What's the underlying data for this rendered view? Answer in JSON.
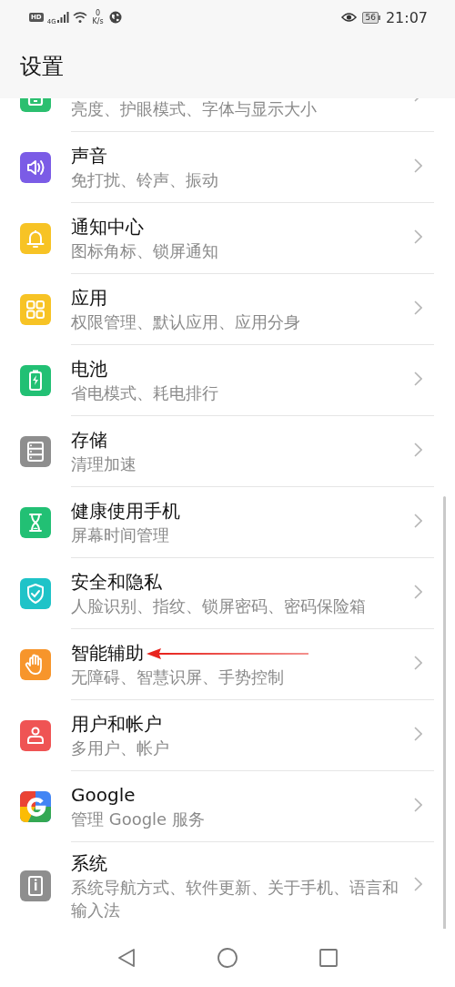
{
  "status_bar": {
    "hd": "HD",
    "network": "4G",
    "speed_value": "0",
    "speed_unit": "K/s",
    "battery": "56",
    "time": "21:07"
  },
  "header": {
    "title": "设置"
  },
  "settings": [
    {
      "kind": "display",
      "color": "#2bbf6f",
      "subtitle": "亮度、护眼模式、字体与显示大小",
      "pointed": false
    },
    {
      "kind": "sound",
      "color": "#7b5ce6",
      "title": "声音",
      "subtitle": "免打扰、铃声、振动",
      "pointed": false
    },
    {
      "kind": "bell",
      "color": "#f7c325",
      "title": "通知中心",
      "subtitle": "图标角标、锁屏通知",
      "pointed": false
    },
    {
      "kind": "apps",
      "color": "#f7c325",
      "title": "应用",
      "subtitle": "权限管理、默认应用、应用分身",
      "pointed": false
    },
    {
      "kind": "battery",
      "color": "#22c074",
      "title": "电池",
      "subtitle": "省电模式、耗电排行",
      "pointed": false
    },
    {
      "kind": "storage",
      "color": "#8e8e8e",
      "title": "存储",
      "subtitle": "清理加速",
      "pointed": false
    },
    {
      "kind": "hourglass",
      "color": "#22c074",
      "title": "健康使用手机",
      "subtitle": "屏幕时间管理",
      "pointed": false
    },
    {
      "kind": "shield",
      "color": "#1fc3c8",
      "title": "安全和隐私",
      "subtitle": "人脸识别、指纹、锁屏密码、密码保险箱",
      "pointed": false
    },
    {
      "kind": "hand",
      "color": "#f7952b",
      "title": "智能辅助",
      "subtitle": "无障碍、智慧识屏、手势控制",
      "pointed": true
    },
    {
      "kind": "user",
      "color": "#ef5454",
      "title": "用户和帐户",
      "subtitle": "多用户、帐户",
      "pointed": false
    },
    {
      "kind": "google",
      "color": "#4285f4",
      "title": "Google",
      "subtitle": "管理 Google 服务",
      "pointed": false
    },
    {
      "kind": "system",
      "color": "#8e8e8e",
      "title": "系统",
      "subtitle": "系统导航方式、软件更新、关于手机、语言和输入法",
      "pointed": false
    }
  ]
}
